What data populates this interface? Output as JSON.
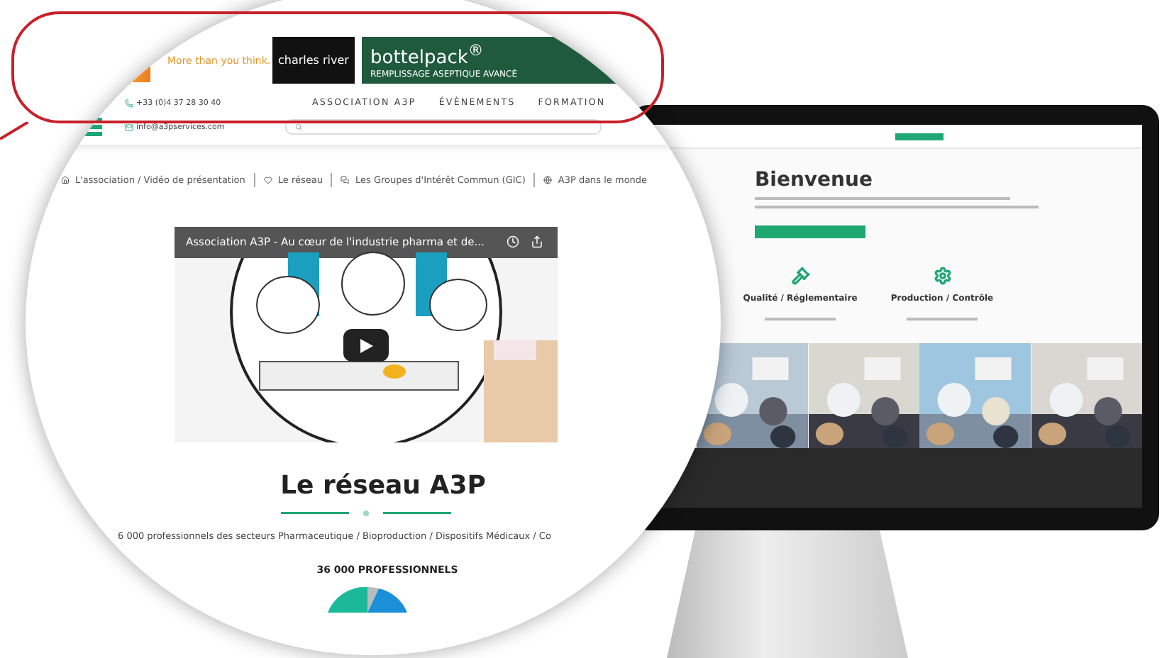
{
  "banner": {
    "tagline": "More than you think.",
    "ads": [
      {
        "kind": "charles",
        "title": "charles river"
      },
      {
        "kind": "bottelpack",
        "title": "bottelpack$^{®}$",
        "subtitle": "REMPLISSAGE ASEPTIQUE AVANCÉ"
      }
    ]
  },
  "contact": {
    "phone": "+33 (0)4 37 28 30 40",
    "email": "info@a3pservices.com"
  },
  "nav": [
    "ASSOCIATION A3P",
    "ÉVÈNEMENTS",
    "FORMATION"
  ],
  "breadcrumb": [
    {
      "kind": "home",
      "label": "L'association / Vidéo de présentation"
    },
    {
      "kind": "heart",
      "label": "Le réseau"
    },
    {
      "kind": "chat",
      "label": "Les Groupes d'Intérêt Commun (GIC)"
    },
    {
      "kind": "globe",
      "label": "A3P dans le monde"
    }
  ],
  "video": {
    "title": "Association A3P - Au cœur de l'industrie pharma et de..."
  },
  "section": {
    "title": "Le réseau A3P",
    "text": "6 000 professionnels des secteurs Pharmaceutique / Bioproduction / Dispositifs Médicaux / Co",
    "count": "36 000 PROFESSIONNELS"
  },
  "monitor": {
    "title": "Bienvenue",
    "features": [
      {
        "kind": "gavel",
        "title": "Qualité / Réglementaire"
      },
      {
        "kind": "gear",
        "title": "Production / Contrôle"
      }
    ]
  }
}
